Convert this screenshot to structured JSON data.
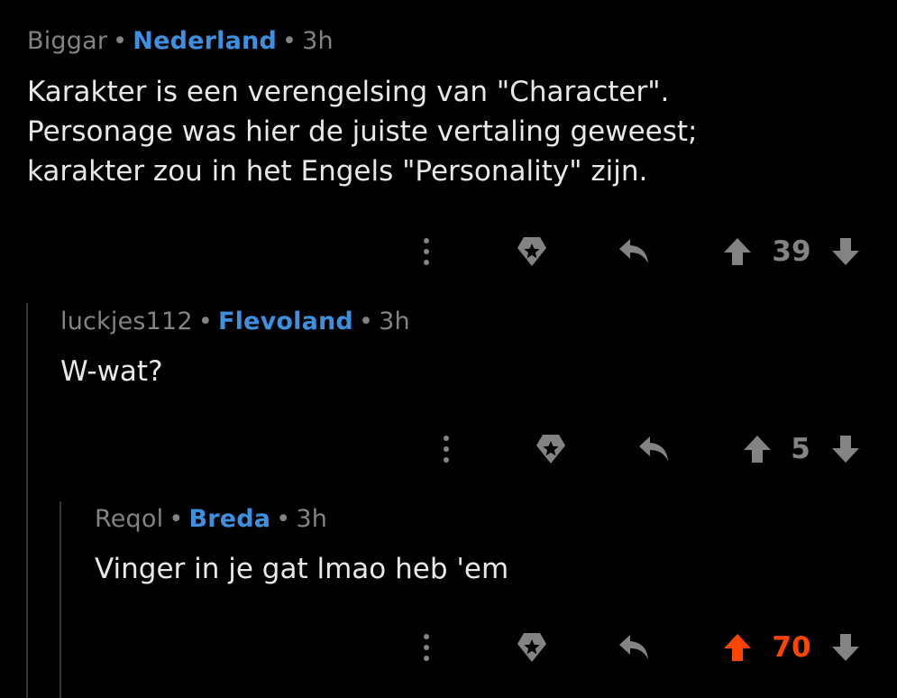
{
  "comments": [
    {
      "user": "Biggar",
      "flair": "Nederland",
      "time": "3h",
      "text": "Karakter is een verengelsing van \"Character\".\nPersonage was hier de juiste vertaling geweest;\nkarakter zou in het Engels \"Personality\" zijn.",
      "score": "39",
      "voted": "none"
    },
    {
      "user": "luckjes112",
      "flair": "Flevoland",
      "time": "3h",
      "text": "W-wat?",
      "score": "5",
      "voted": "none"
    },
    {
      "user": "Reqol",
      "flair": "Breda",
      "time": "3h",
      "text": "Vinger in je gat lmao heb 'em",
      "score": "70",
      "voted": "up"
    }
  ],
  "icons": {
    "more": "more-vertical-icon",
    "award": "award-icon",
    "reply": "reply-icon",
    "upvote": "upvote-arrow-icon",
    "downvote": "downvote-arrow-icon"
  },
  "colors": {
    "background": "#000000",
    "meta": "#818384",
    "flair": "#3d8fe0",
    "text": "#e6e8ea",
    "upvoted": "#ff4500",
    "icon": "#818384"
  },
  "separator": "•"
}
